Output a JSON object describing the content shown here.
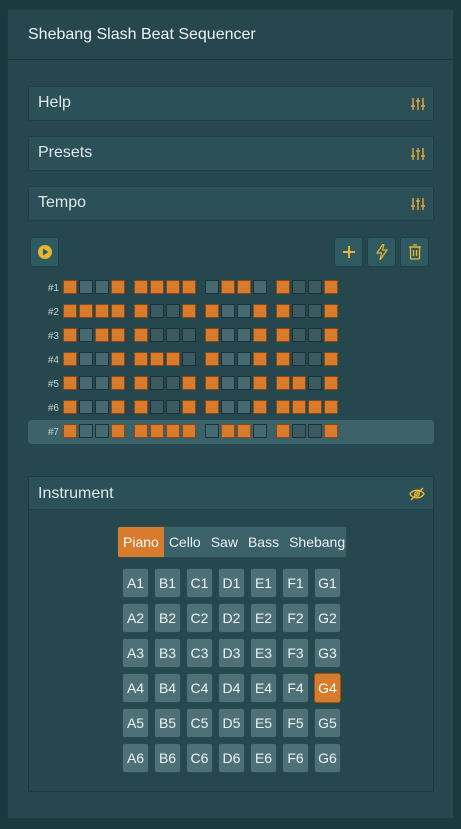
{
  "app": {
    "title": "Shebang Slash Beat Sequencer"
  },
  "panels": [
    {
      "label": "Help",
      "icon": "sliders-icon"
    },
    {
      "label": "Presets",
      "icon": "sliders-icon"
    },
    {
      "label": "Tempo",
      "icon": "sliders-icon"
    }
  ],
  "toolbar": {
    "play_icon": "play-icon",
    "add_icon": "plus-icon",
    "randomize_icon": "lightning-icon",
    "delete_icon": "trash-icon"
  },
  "colors": {
    "accent": "#d97b2c",
    "step_off": "#476a72",
    "background": "#25474d"
  },
  "sequencer": {
    "active_row": 6,
    "rows": [
      {
        "label": "#1",
        "steps": [
          1,
          0,
          0,
          1,
          1,
          1,
          1,
          1,
          0,
          1,
          1,
          0,
          1,
          0,
          0,
          1
        ]
      },
      {
        "label": "#2",
        "steps": [
          1,
          1,
          1,
          1,
          1,
          0,
          0,
          1,
          1,
          0,
          0,
          1,
          1,
          0,
          0,
          1
        ]
      },
      {
        "label": "#3",
        "steps": [
          1,
          0,
          1,
          1,
          1,
          0,
          0,
          0,
          1,
          0,
          0,
          1,
          1,
          0,
          0,
          1
        ]
      },
      {
        "label": "#4",
        "steps": [
          1,
          0,
          0,
          1,
          1,
          1,
          1,
          0,
          1,
          0,
          0,
          1,
          1,
          0,
          0,
          1
        ]
      },
      {
        "label": "#5",
        "steps": [
          1,
          0,
          0,
          1,
          1,
          0,
          0,
          1,
          1,
          0,
          0,
          1,
          1,
          1,
          0,
          1
        ]
      },
      {
        "label": "#6",
        "steps": [
          1,
          0,
          0,
          1,
          1,
          0,
          0,
          1,
          1,
          0,
          0,
          1,
          1,
          1,
          1,
          1
        ]
      },
      {
        "label": "#7",
        "steps": [
          1,
          0,
          0,
          1,
          1,
          1,
          1,
          1,
          0,
          1,
          1,
          0,
          1,
          0,
          0,
          1
        ]
      }
    ]
  },
  "instrument": {
    "title": "Instrument",
    "visibility_icon": "eye-off-icon",
    "tabs": [
      "Piano",
      "Cello",
      "Saw",
      "Bass",
      "Shebang"
    ],
    "selected_tab": "Piano",
    "selected_note": "G4",
    "notes": [
      [
        "A1",
        "B1",
        "C1",
        "D1",
        "E1",
        "F1",
        "G1"
      ],
      [
        "A2",
        "B2",
        "C2",
        "D2",
        "E2",
        "F2",
        "G2"
      ],
      [
        "A3",
        "B3",
        "C3",
        "D3",
        "E3",
        "F3",
        "G3"
      ],
      [
        "A4",
        "B4",
        "C4",
        "D4",
        "E4",
        "F4",
        "G4"
      ],
      [
        "A5",
        "B5",
        "C5",
        "D5",
        "E5",
        "F5",
        "G5"
      ],
      [
        "A6",
        "B6",
        "C6",
        "D6",
        "E6",
        "F6",
        "G6"
      ]
    ]
  }
}
